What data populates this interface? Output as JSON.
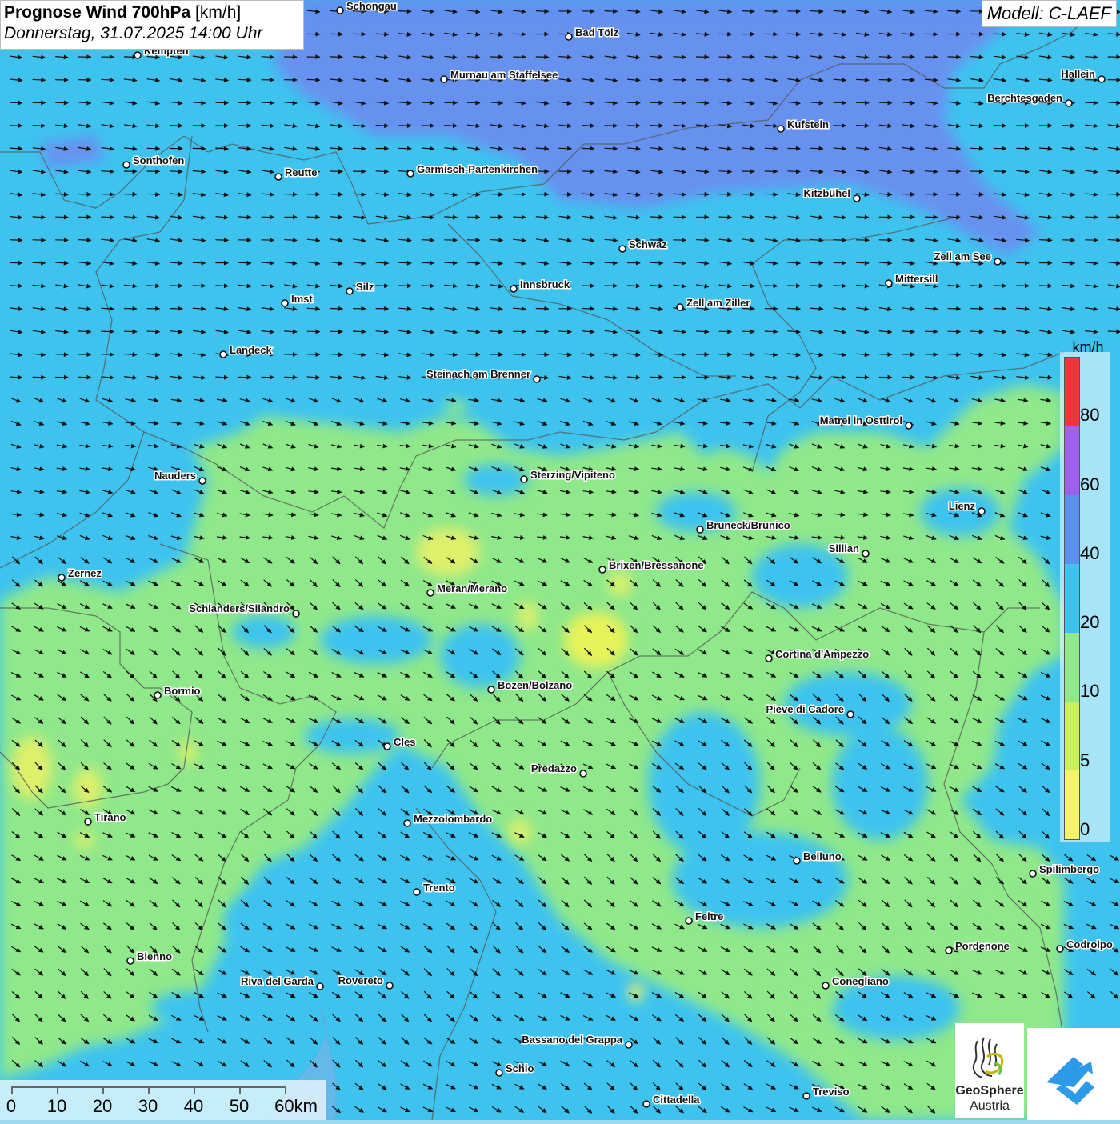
{
  "header": {
    "title_bold": "Prognose Wind 700hPa",
    "title_unit": "[km/h]",
    "datetime": "Donnerstag, 31.07.2025 14:00 Uhr",
    "model": "Modell: C-LAEF"
  },
  "legend": {
    "unit": "km/h",
    "labels": [
      "0",
      "5",
      "10",
      "20",
      "40",
      "60",
      "80"
    ],
    "colors": {
      "0-5": "#f4f46a",
      "5-10": "#c9ef5a",
      "10-20": "#8fe88a",
      "20-40": "#3ec3ef",
      "40-60": "#5b8ff0",
      "60-80": "#a061ef",
      "80+": "#f0353d"
    }
  },
  "scale_bar": {
    "labels": [
      "0",
      "10",
      "20",
      "30",
      "40",
      "50",
      "60km"
    ]
  },
  "logos": {
    "geosphere_line1": "GeoSphere",
    "geosphere_line2": "Austria"
  },
  "wind": {
    "direction": "west-northwest flow (arrows pointing east to southeast)"
  },
  "cities": [
    {
      "name": "Schongau"
    },
    {
      "name": "Bad Tölz"
    },
    {
      "name": "Kempten"
    },
    {
      "name": "Murnau am Staffelsee"
    },
    {
      "name": "Hallein"
    },
    {
      "name": "Berchtesgaden"
    },
    {
      "name": "Kufstein"
    },
    {
      "name": "Sonthofen"
    },
    {
      "name": "Reutte"
    },
    {
      "name": "Garmisch-Partenkirchen"
    },
    {
      "name": "Kitzbühel"
    },
    {
      "name": "Schwaz"
    },
    {
      "name": "Zell am See"
    },
    {
      "name": "Mittersill"
    },
    {
      "name": "Innsbruck"
    },
    {
      "name": "Silz"
    },
    {
      "name": "Imst"
    },
    {
      "name": "Zell am Ziller"
    },
    {
      "name": "Landeck"
    },
    {
      "name": "Steinach am Brenner"
    },
    {
      "name": "Matrei in Osttirol"
    },
    {
      "name": "Nauders"
    },
    {
      "name": "Sterzing/Vipiteno"
    },
    {
      "name": "Lienz"
    },
    {
      "name": "Bruneck/Brunico"
    },
    {
      "name": "Sillian"
    },
    {
      "name": "Zernez"
    },
    {
      "name": "Brixen/Bressanone"
    },
    {
      "name": "Meran/Merano"
    },
    {
      "name": "Schlanders/Silandro"
    },
    {
      "name": "Cortina d'Ampezzo"
    },
    {
      "name": "Bozen/Bolzano"
    },
    {
      "name": "Bormio"
    },
    {
      "name": "Pieve di Cadore"
    },
    {
      "name": "Cles"
    },
    {
      "name": "Predazzo"
    },
    {
      "name": "Tirano"
    },
    {
      "name": "Mezzolombardo"
    },
    {
      "name": "Belluno"
    },
    {
      "name": "Spilimbergo"
    },
    {
      "name": "Trento"
    },
    {
      "name": "Feltre"
    },
    {
      "name": "Pordenone"
    },
    {
      "name": "Codroipo"
    },
    {
      "name": "Bienno"
    },
    {
      "name": "Riva del Garda"
    },
    {
      "name": "Rovereto"
    },
    {
      "name": "Conegliano"
    },
    {
      "name": "Bassano del Grappa"
    },
    {
      "name": "Schio"
    },
    {
      "name": "Treviso"
    },
    {
      "name": "Cittadella"
    }
  ]
}
